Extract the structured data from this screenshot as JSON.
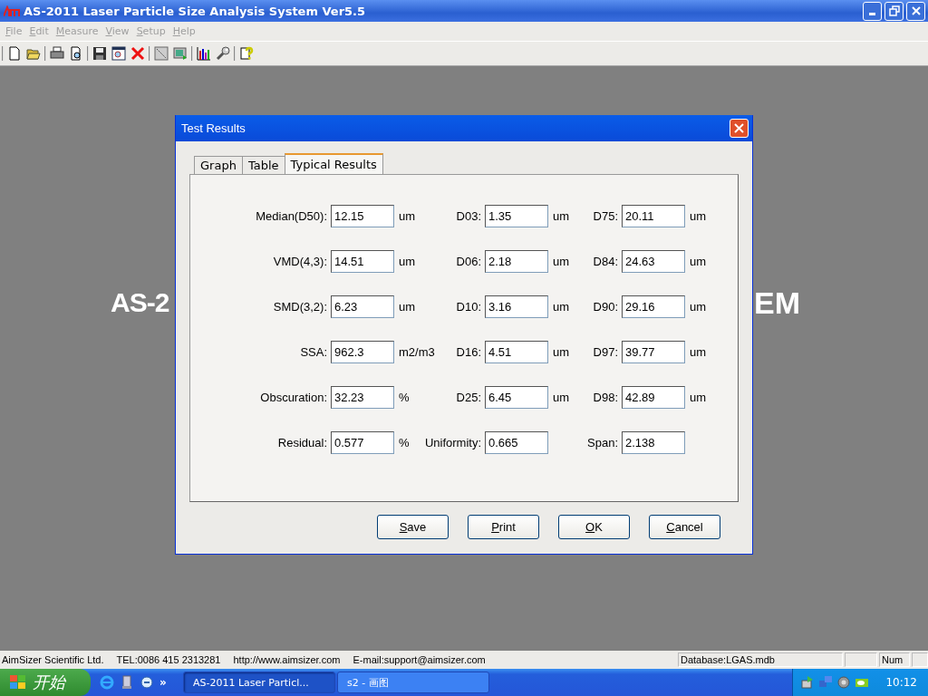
{
  "window": {
    "title": "AS-2011 Laser Particle Size Analysis System Ver5.5"
  },
  "menu": [
    {
      "label": "File",
      "disabled": true
    },
    {
      "label": "Edit",
      "disabled": true
    },
    {
      "label": "Measure",
      "disabled": true
    },
    {
      "label": "View",
      "disabled": true
    },
    {
      "label": "Setup",
      "disabled": true
    },
    {
      "label": "Help",
      "disabled": true
    }
  ],
  "background_text": {
    "left": "AS-2",
    "right": "EM"
  },
  "dialog": {
    "title": "Test Results",
    "tabs": [
      {
        "label": "Graph",
        "selected": false
      },
      {
        "label": "Table",
        "selected": false
      },
      {
        "label": "Typical Results",
        "selected": true
      }
    ],
    "rows": [
      [
        {
          "label": "Median(D50):",
          "value": "12.15",
          "unit": "um"
        },
        {
          "label": "D03:",
          "value": "1.35",
          "unit": "um"
        },
        {
          "label": "D75:",
          "value": "20.11",
          "unit": "um"
        }
      ],
      [
        {
          "label": "VMD(4,3):",
          "value": "14.51",
          "unit": "um"
        },
        {
          "label": "D06:",
          "value": "2.18",
          "unit": "um"
        },
        {
          "label": "D84:",
          "value": "24.63",
          "unit": "um"
        }
      ],
      [
        {
          "label": "SMD(3,2):",
          "value": "6.23",
          "unit": "um"
        },
        {
          "label": "D10:",
          "value": "3.16",
          "unit": "um"
        },
        {
          "label": "D90:",
          "value": "29.16",
          "unit": "um"
        }
      ],
      [
        {
          "label": "SSA:",
          "value": "962.3",
          "unit": "m2/m3"
        },
        {
          "label": "D16:",
          "value": "4.51",
          "unit": "um"
        },
        {
          "label": "D97:",
          "value": "39.77",
          "unit": "um"
        }
      ],
      [
        {
          "label": "Obscuration:",
          "value": "32.23",
          "unit": "%"
        },
        {
          "label": "D25:",
          "value": "6.45",
          "unit": "um"
        },
        {
          "label": "D98:",
          "value": "42.89",
          "unit": "um"
        }
      ],
      [
        {
          "label": "Residual:",
          "value": "0.577",
          "unit": "%"
        },
        {
          "label": "Uniformity:",
          "value": "0.665"
        },
        {
          "label": "Span:",
          "value": "2.138"
        }
      ]
    ],
    "buttons": [
      "Save",
      "Print",
      "OK",
      "Cancel"
    ]
  },
  "status_bar": {
    "texts": [
      "AimSizer Scientific Ltd.",
      "TEL:0086 415 2313281",
      "http://www.aimsizer.com",
      "E-mail:support@aimsizer.com"
    ],
    "panels": [
      "Database:LGAS.mdb",
      "Num"
    ]
  },
  "taskbar": {
    "start": "开始",
    "overflow": "»",
    "tasks": [
      {
        "label": "AS-2011 Laser Particl...",
        "selected": true
      },
      {
        "label": "s2 - 画图",
        "selected": false
      }
    ],
    "clock": "10:12"
  }
}
